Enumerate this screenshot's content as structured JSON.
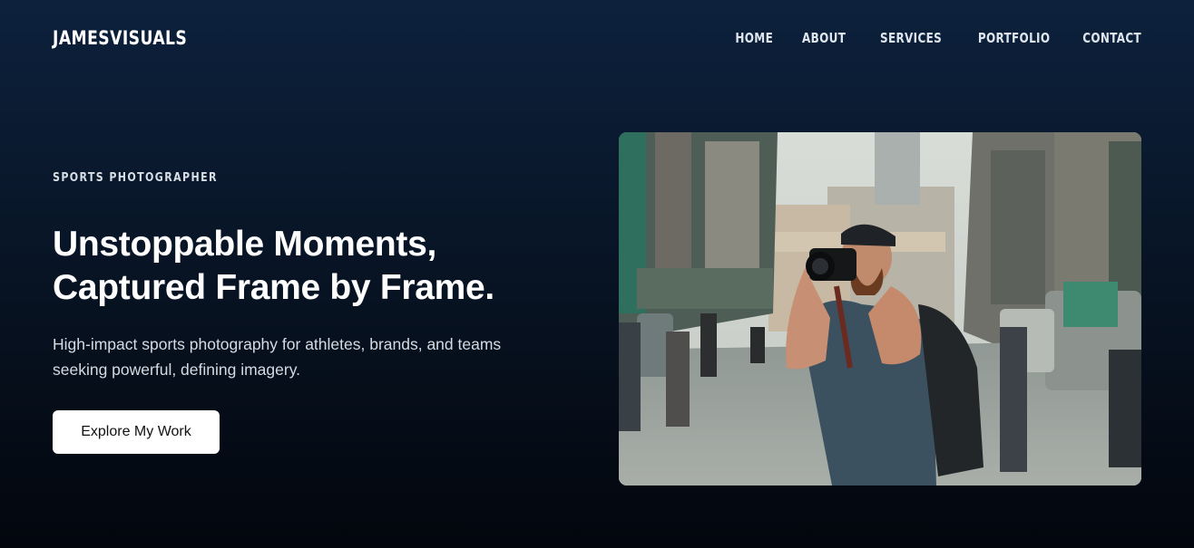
{
  "brand": {
    "logo": "JAMESVISUALS"
  },
  "nav": {
    "items": [
      {
        "label": "HOME"
      },
      {
        "label": "ABOUT"
      },
      {
        "label": "SERVICES"
      },
      {
        "label": "PORTFOLIO"
      },
      {
        "label": "CONTACT"
      }
    ]
  },
  "hero": {
    "kicker": "SPORTS PHOTOGRAPHER",
    "headline_line1": "Unstoppable Moments,",
    "headline_line2": "Captured Frame by Frame.",
    "lead_line1": "High-impact sports photography for athletes, brands, and teams",
    "lead_line2": "seeking powerful, defining imagery.",
    "cta_label": "Explore My Work"
  },
  "colors": {
    "background_top": "#0d213d",
    "background_bottom": "#03060d",
    "cta_background": "#ffffff",
    "text": "#ffffff"
  }
}
